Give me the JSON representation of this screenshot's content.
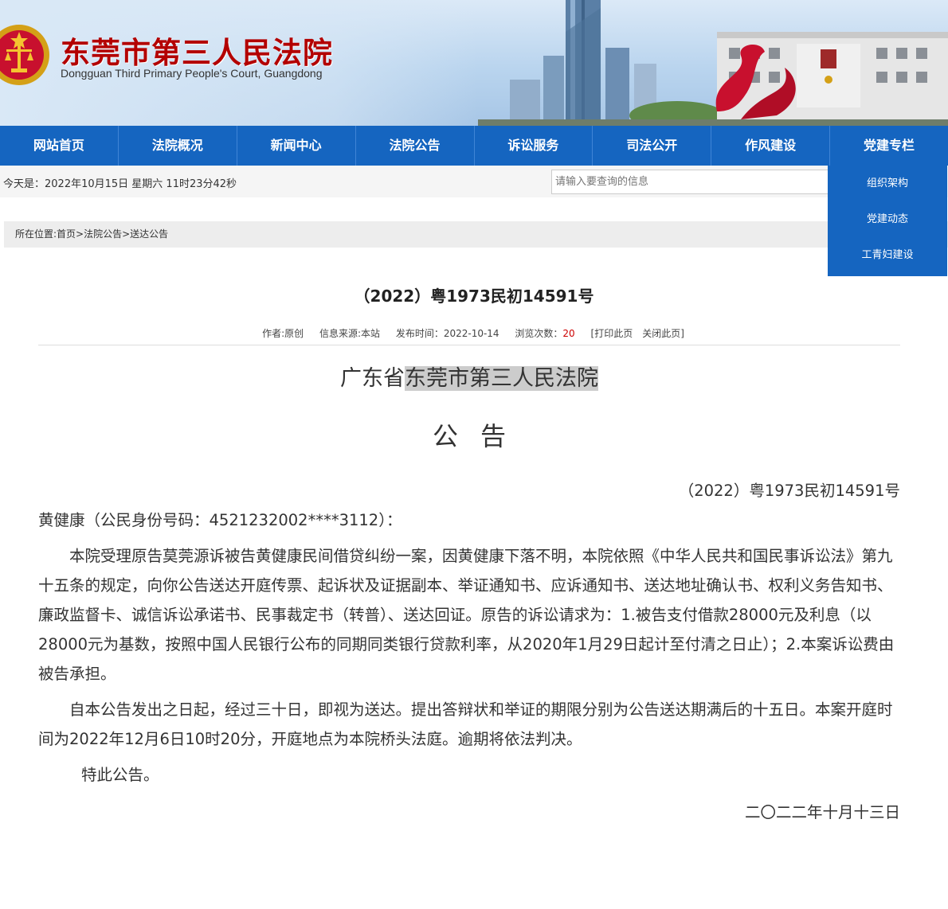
{
  "header": {
    "court_name_cn": "东莞市第三人民法院",
    "court_name_en": "Dongguan Third Primary People's Court, Guangdong"
  },
  "nav": {
    "items": [
      {
        "label": "网站首页"
      },
      {
        "label": "法院概况"
      },
      {
        "label": "新闻中心"
      },
      {
        "label": "法院公告"
      },
      {
        "label": "诉讼服务"
      },
      {
        "label": "司法公开"
      },
      {
        "label": "作风建设"
      },
      {
        "label": "党建专栏"
      }
    ],
    "dropdown": [
      {
        "label": "组织架构"
      },
      {
        "label": "党建动态"
      },
      {
        "label": "工青妇建设"
      }
    ]
  },
  "infobar": {
    "date_text": "今天是：2022年10月15日 星期六 11时23分42秒",
    "search_placeholder": "请输入要查询的信息"
  },
  "breadcrumb": "所在位置:首页>法院公告>送达公告",
  "article": {
    "title": "（2022）粤1973民初14591号",
    "meta": {
      "author": "作者:原创",
      "source": "信息来源:本站",
      "published": "发布时间：2022-10-14",
      "views_label": "浏览次数：",
      "views": "20",
      "print": "[打印此页",
      "close": "关闭此页]"
    },
    "court_prefix": "广东省",
    "court_highlight": "东莞市第三人民法院",
    "notice_heading": "公告",
    "case_no": "（2022）粤1973民初14591号",
    "addressee": "黄健康（公民身份号码：4521232002****3112）：",
    "para1": "本院受理原告莫莞源诉被告黄健康民间借贷纠纷一案，因黄健康下落不明，本院依照《中华人民共和国民事诉讼法》第九十五条的规定，向你公告送达开庭传票、起诉状及证据副本、举证通知书、应诉通知书、送达地址确认书、权利义务告知书、廉政监督卡、诚信诉讼承诺书、民事裁定书（转普）、送达回证。原告的诉讼请求为：1.被告支付借款28000元及利息（以28000元为基数，按照中国人民银行公布的同期同类银行贷款利率，从2020年1月29日起计至付清之日止）；2.本案诉讼费由被告承担。",
    "para2": "自本公告发出之日起，经过三十日，即视为送达。提出答辩状和举证的期限分别为公告送达期满后的十五日。本案开庭时间为2022年12月6日10时20分，开庭地点为本院桥头法庭。逾期将依法判决。",
    "closing": "特此公告。",
    "date": "二〇二二年十月十三日"
  },
  "colors": {
    "nav_bg": "#1565c0",
    "court_name": "#b30000",
    "view_count": "#cc0000"
  }
}
